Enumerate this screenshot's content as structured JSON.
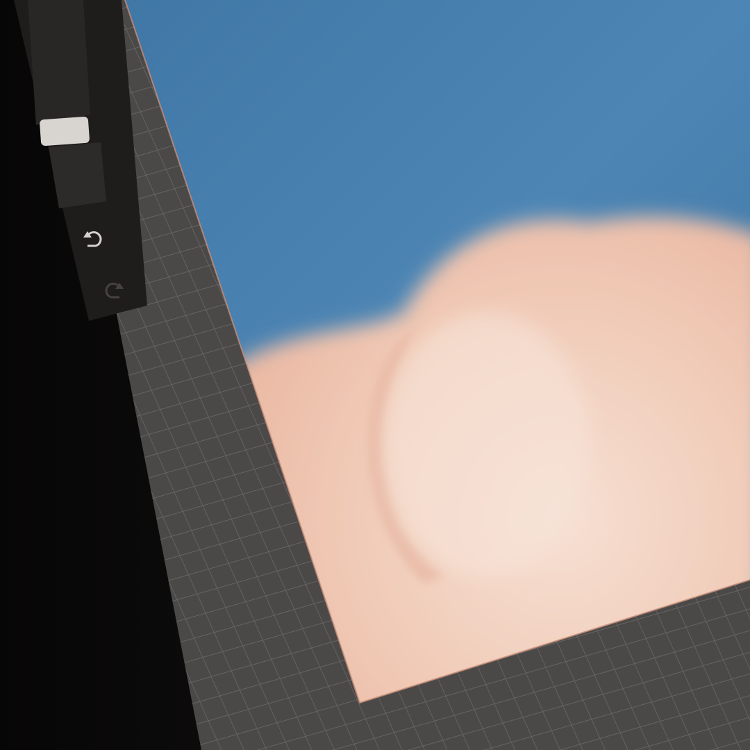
{
  "app": {
    "kind": "drawing-app-canvas-photo"
  },
  "sidebar": {
    "brush_size_slider": {
      "icon": "slider-thumb"
    },
    "opacity_slider": {
      "icon": "slider-track"
    },
    "undo_button": {
      "icon": "undo-arrow-icon"
    },
    "redo_button": {
      "icon": "redo-arrow-icon"
    }
  },
  "canvas": {
    "content": "sky-with-pink-cloud",
    "colors": {
      "sky": "#3f78a6",
      "sky_light": "#5a8fbe",
      "cloud": "#f1c9b4",
      "cloud_shadow": "#e1a791",
      "cloud_highlight": "#f7e2d4",
      "canvas_edge": "#c98e78"
    }
  },
  "workspace": {
    "grid": true,
    "colors": {
      "background": "#4b4948",
      "grid_line": "#6a6867"
    }
  }
}
